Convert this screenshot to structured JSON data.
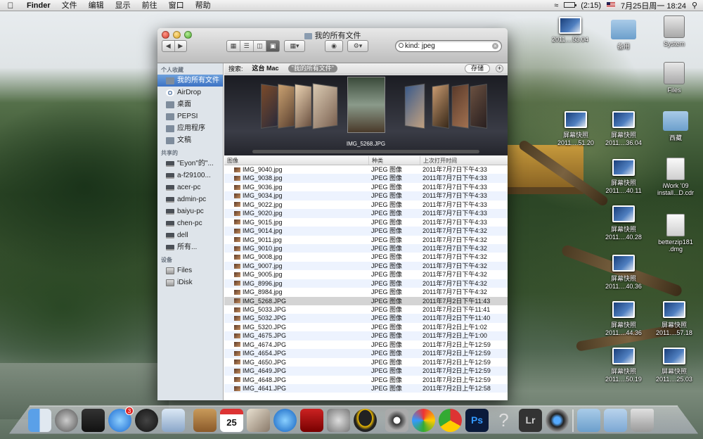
{
  "menubar": {
    "app_name": "Finder",
    "menus": [
      "文件",
      "编辑",
      "显示",
      "前往",
      "窗口",
      "帮助"
    ],
    "battery": "(2:15)",
    "datetime": "7月25日周一  18:24"
  },
  "desktop_icons": [
    {
      "label": "2011....53.04",
      "kind": "screenshot"
    },
    {
      "label": "备用",
      "kind": "folder"
    },
    {
      "label": "System",
      "kind": "drive"
    },
    {
      "label": "Files",
      "kind": "drive"
    },
    {
      "label": "屏幕快照\n2011....51.20",
      "kind": "screenshot"
    },
    {
      "label": "屏幕快照\n2011....36.04",
      "kind": "screenshot"
    },
    {
      "label": "西藏",
      "kind": "folder"
    },
    {
      "label": "屏幕快照\n2011....40.11",
      "kind": "screenshot"
    },
    {
      "label": "iWork '09\ninstall...D.cdr",
      "kind": "doc"
    },
    {
      "label": "屏幕快照\n2011....40.28",
      "kind": "screenshot"
    },
    {
      "label": "betterzip181\n.dmg",
      "kind": "doc"
    },
    {
      "label": "屏幕快照\n2011....40.36",
      "kind": "screenshot"
    },
    {
      "label": "屏幕快照\n2011....44.36",
      "kind": "screenshot"
    },
    {
      "label": "屏幕快照\n2011....57.18",
      "kind": "screenshot"
    },
    {
      "label": "屏幕快照\n2011....50.19",
      "kind": "screenshot"
    },
    {
      "label": "屏幕快照\n2011....25.03",
      "kind": "screenshot"
    }
  ],
  "window": {
    "title": "我的所有文件",
    "search_value": "kind: jpeg",
    "sidebar": {
      "favorites_heading": "个人收藏",
      "favorites": [
        "我的所有文件",
        "AirDrop",
        "桌面",
        "PEPSI",
        "应用程序",
        "文稿"
      ],
      "shared_heading": "共享的",
      "shared": [
        "\"Eyon\"的\"...",
        "a-f29100...",
        "acer-pc",
        "admin-pc",
        "baiyu-pc",
        "chen-pc",
        "dell",
        "所有..."
      ],
      "devices_heading": "设备",
      "devices": [
        "Files",
        "iDisk"
      ]
    },
    "scope": {
      "label": "搜索:",
      "this_mac": "这台 Mac",
      "all_files": "\"我的所有文件\"",
      "save": "存储"
    },
    "coverflow": {
      "selected_label": "IMG_5268.JPG"
    },
    "columns": {
      "name": "图像",
      "kind": "种类",
      "date": "上次打开时间"
    },
    "rows": [
      {
        "name": "IMG_9040.jpg",
        "kind": "JPEG 图像",
        "date": "2011年7月7日下午4:33"
      },
      {
        "name": "IMG_9038.jpg",
        "kind": "JPEG 图像",
        "date": "2011年7月7日下午4:33"
      },
      {
        "name": "IMG_9036.jpg",
        "kind": "JPEG 图像",
        "date": "2011年7月7日下午4:33"
      },
      {
        "name": "IMG_9034.jpg",
        "kind": "JPEG 图像",
        "date": "2011年7月7日下午4:33"
      },
      {
        "name": "IMG_9022.jpg",
        "kind": "JPEG 图像",
        "date": "2011年7月7日下午4:33"
      },
      {
        "name": "IMG_9020.jpg",
        "kind": "JPEG 图像",
        "date": "2011年7月7日下午4:33"
      },
      {
        "name": "IMG_9015.jpg",
        "kind": "JPEG 图像",
        "date": "2011年7月7日下午4:33"
      },
      {
        "name": "IMG_9014.jpg",
        "kind": "JPEG 图像",
        "date": "2011年7月7日下午4:32"
      },
      {
        "name": "IMG_9011.jpg",
        "kind": "JPEG 图像",
        "date": "2011年7月7日下午4:32"
      },
      {
        "name": "IMG_9010.jpg",
        "kind": "JPEG 图像",
        "date": "2011年7月7日下午4:32"
      },
      {
        "name": "IMG_9008.jpg",
        "kind": "JPEG 图像",
        "date": "2011年7月7日下午4:32"
      },
      {
        "name": "IMG_9007.jpg",
        "kind": "JPEG 图像",
        "date": "2011年7月7日下午4:32"
      },
      {
        "name": "IMG_9005.jpg",
        "kind": "JPEG 图像",
        "date": "2011年7月7日下午4:32"
      },
      {
        "name": "IMG_8996.jpg",
        "kind": "JPEG 图像",
        "date": "2011年7月7日下午4:32"
      },
      {
        "name": "IMG_8984.jpg",
        "kind": "JPEG 图像",
        "date": "2011年7月7日下午4:32"
      },
      {
        "name": "IMG_5268.JPG",
        "kind": "JPEG 图像",
        "date": "2011年7月2日下午11:43",
        "selected": true
      },
      {
        "name": "IMG_5033.JPG",
        "kind": "JPEG 图像",
        "date": "2011年7月2日下午11:41"
      },
      {
        "name": "IMG_5032.JPG",
        "kind": "JPEG 图像",
        "date": "2011年7月2日下午11:40"
      },
      {
        "name": "IMG_5320.JPG",
        "kind": "JPEG 图像",
        "date": "2011年7月2日上午1:02"
      },
      {
        "name": "IMG_4675.JPG",
        "kind": "JPEG 图像",
        "date": "2011年7月2日上午1:00"
      },
      {
        "name": "IMG_4674.JPG",
        "kind": "JPEG 图像",
        "date": "2011年7月2日上午12:59"
      },
      {
        "name": "IMG_4654.JPG",
        "kind": "JPEG 图像",
        "date": "2011年7月2日上午12:59"
      },
      {
        "name": "IMG_4650.JPG",
        "kind": "JPEG 图像",
        "date": "2011年7月2日上午12:59"
      },
      {
        "name": "IMG_4649.JPG",
        "kind": "JPEG 图像",
        "date": "2011年7月2日上午12:59"
      },
      {
        "name": "IMG_4648.JPG",
        "kind": "JPEG 图像",
        "date": "2011年7月2日上午12:59"
      },
      {
        "name": "IMG_4641.JPG",
        "kind": "JPEG 图像",
        "date": "2011年7月2日上午12:58"
      }
    ]
  },
  "dock": {
    "app_store_badge": "3",
    "calendar_day": "25",
    "icons": [
      "finder-icon",
      "launchpad-icon",
      "mission-control-icon",
      "app-store-icon",
      "dashboard-icon",
      "mail-icon",
      "address-book-icon",
      "ical-icon",
      "iphoto-icon",
      "itunes-icon",
      "photo-booth-icon",
      "system-preferences-icon",
      "qq-icon",
      "dvd-player-icon",
      "picasa-icon",
      "chrome-icon",
      "photoshop-icon",
      "help-icon",
      "lightroom-icon",
      "camera-icon",
      "applications-stack-icon",
      "documents-stack-icon",
      "trash-icon"
    ]
  }
}
